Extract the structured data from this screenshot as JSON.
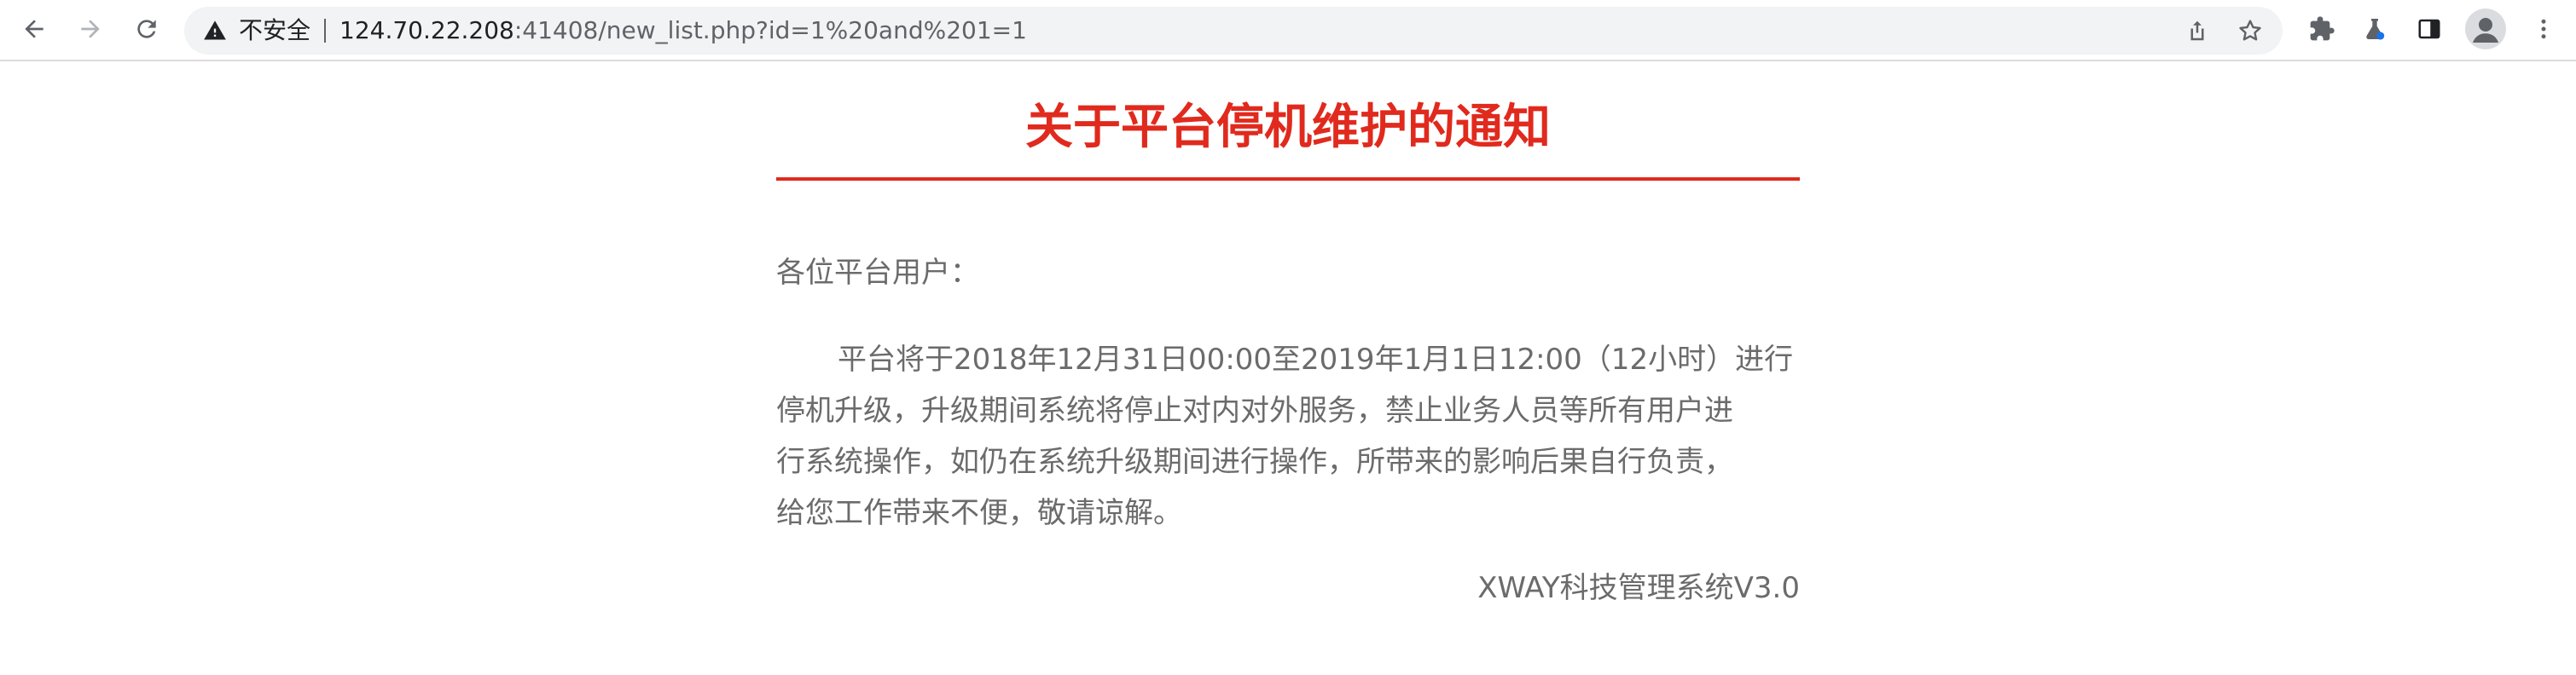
{
  "browser": {
    "insecure_label": "不安全",
    "url_host": "124.70.22.208",
    "url_rest": ":41408/new_list.php?id=1%20and%201=1",
    "icons": {
      "back": "arrow-left-icon",
      "forward": "arrow-right-icon",
      "reload": "reload-icon",
      "warning": "warning-triangle-icon",
      "share": "share-icon",
      "bookmark": "star-icon",
      "extensions": "puzzle-icon",
      "labs": "flask-icon",
      "side_panel": "side-panel-icon",
      "profile": "avatar-icon",
      "menu": "kebab-menu-icon"
    }
  },
  "notice": {
    "title": "关于平台停机维护的通知",
    "greeting": "各位平台用户：",
    "body_lines": [
      "平台将于2018年12月31日00:00至2019年1月1日12:00（12小时）进行",
      "停机升级，升级期间系统将停止对内对外服务，禁止业务人员等所有用户进",
      "行系统操作，如仍在系统升级期间进行操作，所带来的影响后果自行负责，",
      "给您工作带来不便，敬请谅解。"
    ],
    "signature": "XWAY科技管理系统V3.0"
  },
  "colors": {
    "title_red": "#e02a1d",
    "body_gray": "#6b6b6b",
    "omnibox_bg": "#f1f3f4"
  }
}
